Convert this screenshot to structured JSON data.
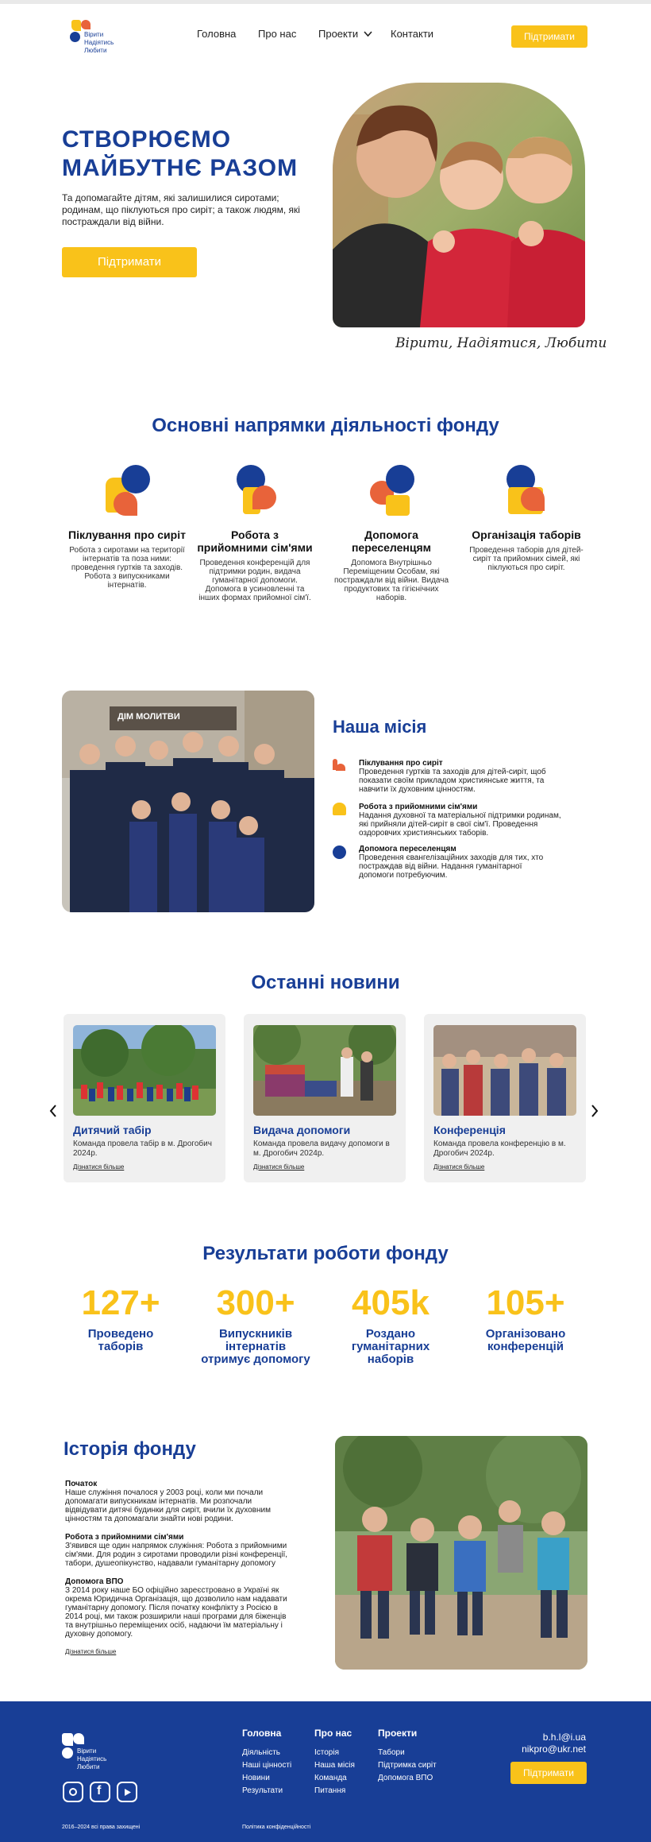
{
  "header": {
    "logo_lines": [
      "Вірити",
      "Надіятись",
      "Любити"
    ],
    "nav": [
      {
        "label": "Головна"
      },
      {
        "label": "Про нас"
      },
      {
        "label": "Проекти"
      },
      {
        "label": "Контакти"
      }
    ],
    "support_label": "Підтримати"
  },
  "hero": {
    "title_line1": "СТВОРЮЄМО",
    "title_line2": "МАЙБУТНЄ РАЗОМ",
    "subtitle": "Та допомагайте дітям, які залишилися сиротами; родинам, що піклуються про сиріт; а також людям, які постраждали від війни.",
    "button_label": "Підтримати",
    "tagline": "Вірити, Надіятися, Любити"
  },
  "directions": {
    "title": "Основні напрямки діяльності фонду",
    "items": [
      {
        "title": "Піклування про сиріт",
        "text": "Робота з сиротами на території інтернатів та поза ними: проведення гуртків та заходів. Робота з випускниками інтернатів."
      },
      {
        "title": "Робота з прийомними сім'ями",
        "text": "Проведення конференцій для підтримки родин, видача гуманітарної допомоги. Допомога в усиновленні та інших формах прийомної сім'ї."
      },
      {
        "title": "Допомога переселенцям",
        "text": "Допомога Внутрішньо Переміщеним Особам, які постраждали від війни. Видача продуктових та гігієнічних наборів."
      },
      {
        "title": "Організація таборів",
        "text": "Проведення таборів для дітей-сиріт та прийомних сімей, які піклуються про сиріт."
      }
    ]
  },
  "mission": {
    "title": "Наша місія",
    "sign_text": "ДІМ МОЛИТВИ",
    "items": [
      {
        "title": "Піклування про сиріт",
        "text": "Проведення гуртків та заходів для дітей-сиріт, щоб показати своїм прикладом християнське життя, та навчити їх духовним цінностям."
      },
      {
        "title": "Робота з прийомними сім'ями",
        "text": "Надання духовної та матеріальної підтримки родинам, які прийняли дітей-сиріт в свої сім'ї. Проведення оздоровчих християнських таборів."
      },
      {
        "title": "Допомога переселенцям",
        "text": "Проведення євангелізаційних заходів для тих, хто постраждав від війни. Надання гуманітарної допомоги потребуючим."
      }
    ]
  },
  "news": {
    "title": "Останні новини",
    "items": [
      {
        "title": "Дитячий табір",
        "text": "Команда провела табір в м. Дрогобич 2024р.",
        "more": "Дізнатися більше"
      },
      {
        "title": "Видача допомоги",
        "text": "Команда провела видачу допомоги в м. Дрогобич 2024р.",
        "more": "Дізнатися більше"
      },
      {
        "title": "Конференція",
        "text": "Команда провела конференцію в м. Дрогобич 2024р.",
        "more": "Дізнатися більше"
      }
    ]
  },
  "results": {
    "title": "Результати роботи фонду",
    "items": [
      {
        "value": "127+",
        "label_line1": "Проведено",
        "label_line2": "таборів",
        "label_line3": ""
      },
      {
        "value": "300+",
        "label_line1": "Випускників",
        "label_line2": "інтернатів",
        "label_line3": "отримує допомогу"
      },
      {
        "value": "405k",
        "label_line1": "Роздано",
        "label_line2": "гуманітарних",
        "label_line3": "наборів"
      },
      {
        "value": "105+",
        "label_line1": "Організовано",
        "label_line2": "конференцій",
        "label_line3": ""
      }
    ]
  },
  "history": {
    "title": "Історія фонду",
    "blocks": [
      {
        "heading": "Початок",
        "text": "Наше служіння почалося у 2003 році, коли ми почали допомагати випускникам інтернатів. Ми розпочали відвідувати дитячі будинки для сиріт, вчили їх духовним цінностям та допомагали знайти нові родини."
      },
      {
        "heading": "Робота з прийомними сім'ями",
        "text": "З'явився ще один напрямок служіння: Робота з прийомними сім'ями. Для родин з сиротами проводили різні конференції, табори, душеопікунство, надавали гуманітарну допомогу"
      },
      {
        "heading": "Допомога ВПО",
        "text": "З 2014 року наше БО офіційно зареєстровано в Україні як окрема Юридична Організація, що дозволило нам надавати гуманітарну допомогу. Після початку конфлікту з Росією в 2014 році, ми також розширили наші програми для біженців та внутрішньо переміщених осіб, надаючи їм матеріальну і духовну допомогу."
      }
    ],
    "more": "Дізнатися більше"
  },
  "footer": {
    "col1_title": "Головна",
    "col1": [
      "Діяльність",
      "Наші цінності",
      "Новини",
      "Результати"
    ],
    "col2_title": "Про нас",
    "col2": [
      "Історія",
      "Наша місія",
      "Команда",
      "Питання"
    ],
    "col3_title": "Проекти",
    "col3": [
      "Табори",
      "Підтримка сиріт",
      "Допомога ВПО"
    ],
    "email1": "b.h.l@i.ua",
    "email2": "nikpro@ukr.net",
    "support_label": "Підтримати",
    "copyright": "2016–2024 всі права захищені",
    "privacy": "Політика конфіденційності"
  },
  "colors": {
    "accent": "#f9c21a",
    "brand_blue": "#183e96",
    "brand_orange": "#e8633a"
  },
  "icons": [
    "chevron-down-icon",
    "chevron-left-icon",
    "chevron-right-icon",
    "instagram-icon",
    "facebook-icon",
    "youtube-icon"
  ]
}
